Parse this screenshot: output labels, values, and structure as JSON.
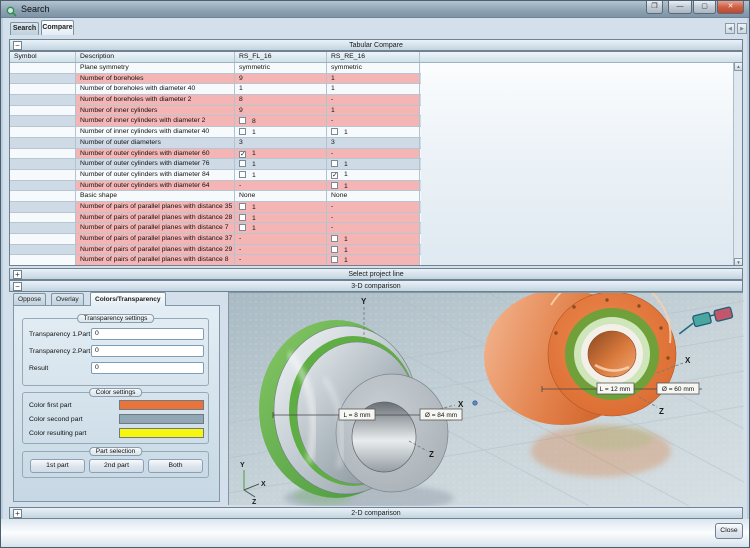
{
  "window": {
    "title": "Search"
  },
  "icons": {
    "minimize": "—",
    "maximize": "▢",
    "restore": "❐",
    "close": "✕",
    "tab_prev": "◀",
    "tab_next": "▶",
    "scroll_up": "▲",
    "scroll_down": "▼",
    "collapse": "−",
    "expand": "+",
    "check": "✓"
  },
  "tabs": {
    "search": "Search",
    "compare": "Compare"
  },
  "sections": {
    "tabular": {
      "label": "Tabular Compare",
      "expander": "−"
    },
    "select_project": {
      "label": "Select project line",
      "expander": "+"
    },
    "threed": {
      "label": "3-D comparison",
      "expander": "−"
    },
    "twod": {
      "label": "2-D comparison",
      "expander": "+"
    }
  },
  "table": {
    "columns": [
      "Symbol",
      "Description",
      "RS_FL_16",
      "RS_RE_16"
    ],
    "rows": [
      {
        "d": "Plane symmetry",
        "fl": {
          "t": "symmetric"
        },
        "re": {
          "t": "symmetric"
        },
        "diff": false
      },
      {
        "d": "Number of boreholes",
        "fl": {
          "t": "9"
        },
        "re": {
          "t": "1"
        },
        "diff": true
      },
      {
        "d": "Number of boreholes with diameter 40",
        "fl": {
          "t": "1"
        },
        "re": {
          "t": "1"
        },
        "diff": false
      },
      {
        "d": "Number of boreholes with diameter 2",
        "fl": {
          "t": "8"
        },
        "re": {
          "t": "-"
        },
        "diff": true
      },
      {
        "d": "Number of inner cylinders",
        "fl": {
          "t": "9"
        },
        "re": {
          "t": "1"
        },
        "diff": true
      },
      {
        "d": "Number of inner cylinders with diameter 2",
        "fl": {
          "t": "8",
          "cb": "unchecked"
        },
        "re": {
          "t": "-"
        },
        "diff": true
      },
      {
        "d": "Number of inner cylinders with diameter 40",
        "fl": {
          "t": "1",
          "cb": "unchecked"
        },
        "re": {
          "t": "1",
          "cb": "unchecked"
        },
        "diff": false
      },
      {
        "d": "Number of outer diameters",
        "fl": {
          "t": "3"
        },
        "re": {
          "t": "3"
        },
        "diff": false
      },
      {
        "d": "Number of outer cylinders with diameter 60",
        "fl": {
          "t": "1",
          "cb": "checked"
        },
        "re": {
          "t": "-"
        },
        "diff": true
      },
      {
        "d": "Number of outer cylinders with diameter 76",
        "fl": {
          "t": "1",
          "cb": "unchecked"
        },
        "re": {
          "t": "1",
          "cb": "unchecked"
        },
        "diff": false
      },
      {
        "d": "Number of outer cylinders with diameter 84",
        "fl": {
          "t": "1",
          "cb": "unchecked"
        },
        "re": {
          "t": "1",
          "cb": "checked"
        },
        "diff": false
      },
      {
        "d": "Number of outer cylinders with diameter 64",
        "fl": {
          "t": "-"
        },
        "re": {
          "t": "1",
          "cb": "unchecked"
        },
        "diff": true
      },
      {
        "d": "Basic shape",
        "fl": {
          "t": "None"
        },
        "re": {
          "t": "None"
        },
        "diff": false
      },
      {
        "d": "Number of pairs of parallel planes with distance 35",
        "fl": {
          "t": "1",
          "cb": "unchecked"
        },
        "re": {
          "t": "-"
        },
        "diff": true
      },
      {
        "d": "Number of pairs of parallel planes with distance 28",
        "fl": {
          "t": "1",
          "cb": "unchecked"
        },
        "re": {
          "t": "-"
        },
        "diff": true
      },
      {
        "d": "Number of pairs of parallel planes with distance 7",
        "fl": {
          "t": "1",
          "cb": "unchecked"
        },
        "re": {
          "t": "-"
        },
        "diff": true
      },
      {
        "d": "Number of pairs of parallel planes with distance 37",
        "fl": {
          "t": "-"
        },
        "re": {
          "t": "1",
          "cb": "unchecked"
        },
        "diff": true
      },
      {
        "d": "Number of pairs of parallel planes with distance 29",
        "fl": {
          "t": "-"
        },
        "re": {
          "t": "1",
          "cb": "unchecked"
        },
        "diff": true
      },
      {
        "d": "Number of pairs of parallel planes with distance 8",
        "fl": {
          "t": "-"
        },
        "re": {
          "t": "1",
          "cb": "unchecked"
        },
        "diff": true
      }
    ]
  },
  "panel": {
    "tabs": {
      "oppose": "Oppose",
      "overlay": "Overlay",
      "colors": "Colors/Transparency"
    },
    "transparency": {
      "title": "Transparency settings",
      "fields": [
        {
          "label": "Transparency 1.Part",
          "value": "0"
        },
        {
          "label": "Transparency 2.Part",
          "value": "0"
        },
        {
          "label": "Result",
          "value": "0"
        }
      ]
    },
    "colors": {
      "title": "Color settings",
      "items": [
        {
          "label": "Color first part",
          "color": "#e8743c"
        },
        {
          "label": "Color second part",
          "color": "#91a7b3"
        },
        {
          "label": "Color resulting part",
          "color": "#f6f611"
        }
      ]
    },
    "part_selection": {
      "title": "Part selection",
      "buttons": [
        "1st part",
        "2nd part",
        "Both"
      ]
    }
  },
  "viewport": {
    "labels": {
      "part1_length": "L = 8 mm",
      "part1_diameter": "Ø = 84 mm",
      "part2_length": "L = 12 mm",
      "part2_diameter": "Ø = 60 mm"
    },
    "axes": {
      "x": "X",
      "y": "Y",
      "z": "Z"
    }
  },
  "footer": {
    "close_label": "Close"
  }
}
